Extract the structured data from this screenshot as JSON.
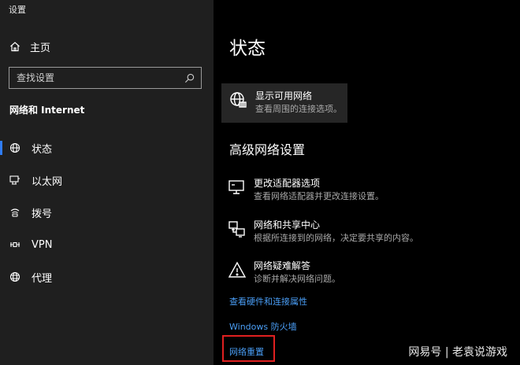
{
  "window": {
    "title": "设置"
  },
  "sidebar": {
    "home_label": "主页",
    "search_placeholder": "查找设置",
    "section_label": "网络和 Internet",
    "items": [
      {
        "label": "状态",
        "icon": "globe-status-icon",
        "active": true
      },
      {
        "label": "以太网",
        "icon": "ethernet-icon"
      },
      {
        "label": "拨号",
        "icon": "dialup-icon"
      },
      {
        "label": "VPN",
        "icon": "vpn-icon"
      },
      {
        "label": "代理",
        "icon": "proxy-globe-icon"
      }
    ]
  },
  "main": {
    "title": "状态",
    "show_networks": {
      "title": "显示可用网络",
      "desc": "查看周围的连接选项。",
      "icon": "globe-network-icon"
    },
    "advanced_heading": "高级网络设置",
    "options": [
      {
        "title": "更改适配器选项",
        "desc": "查看网络适配器并更改连接设置。",
        "icon": "monitor-adapter-icon"
      },
      {
        "title": "网络和共享中心",
        "desc": "根据所连接到的网络，决定要共享的内容。",
        "icon": "sharing-center-icon"
      },
      {
        "title": "网络疑难解答",
        "desc": "诊断并解决网络问题。",
        "icon": "warning-icon"
      }
    ],
    "links": [
      "查看硬件和连接属性",
      "Windows 防火墙",
      "网络重置"
    ],
    "highlight_color": "#e02020",
    "accent_color": "#2f7cf6",
    "link_color": "#4a9ef6"
  },
  "watermark": "网易号 | 老袁说游戏"
}
